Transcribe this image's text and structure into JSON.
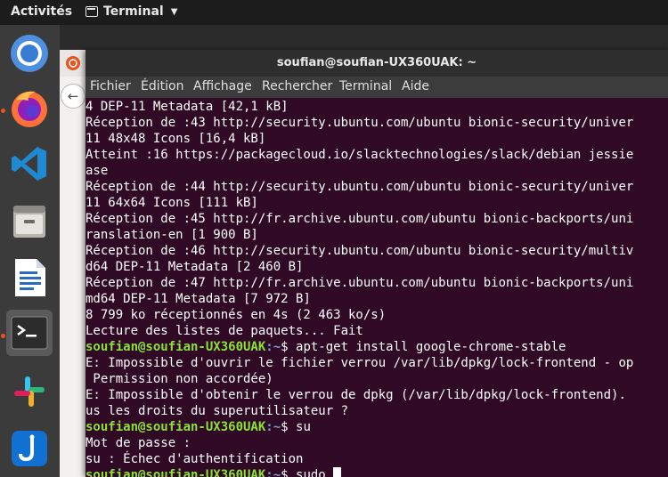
{
  "topbar": {
    "activities": "Activités",
    "app_name": "Terminal"
  },
  "dock": {
    "items": [
      {
        "name": "chromium"
      },
      {
        "name": "firefox"
      },
      {
        "name": "vscode"
      },
      {
        "name": "files"
      },
      {
        "name": "libreoffice-writer"
      },
      {
        "name": "terminal"
      },
      {
        "name": "slack"
      },
      {
        "name": "joplin"
      }
    ]
  },
  "window": {
    "title": "soufian@soufian-UX360UAK: ~",
    "menu": [
      "Fichier",
      "Édition",
      "Affichage",
      "Rechercher",
      "Terminal",
      "Aide"
    ]
  },
  "terminal": {
    "lines": [
      "4 DEP-11 Metadata [42,1 kB]",
      "Réception de :43 http://security.ubuntu.com/ubuntu bionic-security/univer",
      "11 48x48 Icons [16,4 kB]",
      "Atteint :16 https://packagecloud.io/slacktechnologies/slack/debian jessie",
      "ase",
      "Réception de :44 http://security.ubuntu.com/ubuntu bionic-security/univer",
      "11 64x64 Icons [111 kB]",
      "Réception de :45 http://fr.archive.ubuntu.com/ubuntu bionic-backports/uni",
      "ranslation-en [1 900 B]",
      "Réception de :46 http://security.ubuntu.com/ubuntu bionic-security/multiv",
      "d64 DEP-11 Metadata [2 460 B]",
      "Réception de :47 http://fr.archive.ubuntu.com/ubuntu bionic-backports/uni",
      "md64 DEP-11 Metadata [7 972 B]",
      "8 799 ko réceptionnés en 4s (2 463 ko/s)",
      "Lecture des listes de paquets... Fait"
    ],
    "prompt_user": "soufian@soufian-UX360UAK",
    "prompt_path": ":~",
    "prompt_sign": "$ ",
    "cmd1": "apt-get install google-chrome-stable",
    "err1a": "E: Impossible d'ouvrir le fichier verrou /var/lib/dpkg/lock-frontend - op",
    "err1b": " Permission non accordée)",
    "err2a": "E: Impossible d'obtenir le verrou de dpkg (/var/lib/dpkg/lock-frontend). ",
    "err2b": "us les droits du superutilisateur ?",
    "cmd2": "su",
    "pw": "Mot de passe :",
    "su_fail": "su : Échec d'authentification",
    "cmd3": "sudo "
  },
  "colors": {
    "terminal_bg": "#300a24",
    "prompt_user": "#8ae234",
    "prompt_path": "#729fcf",
    "ubuntu_orange": "#e95420"
  }
}
